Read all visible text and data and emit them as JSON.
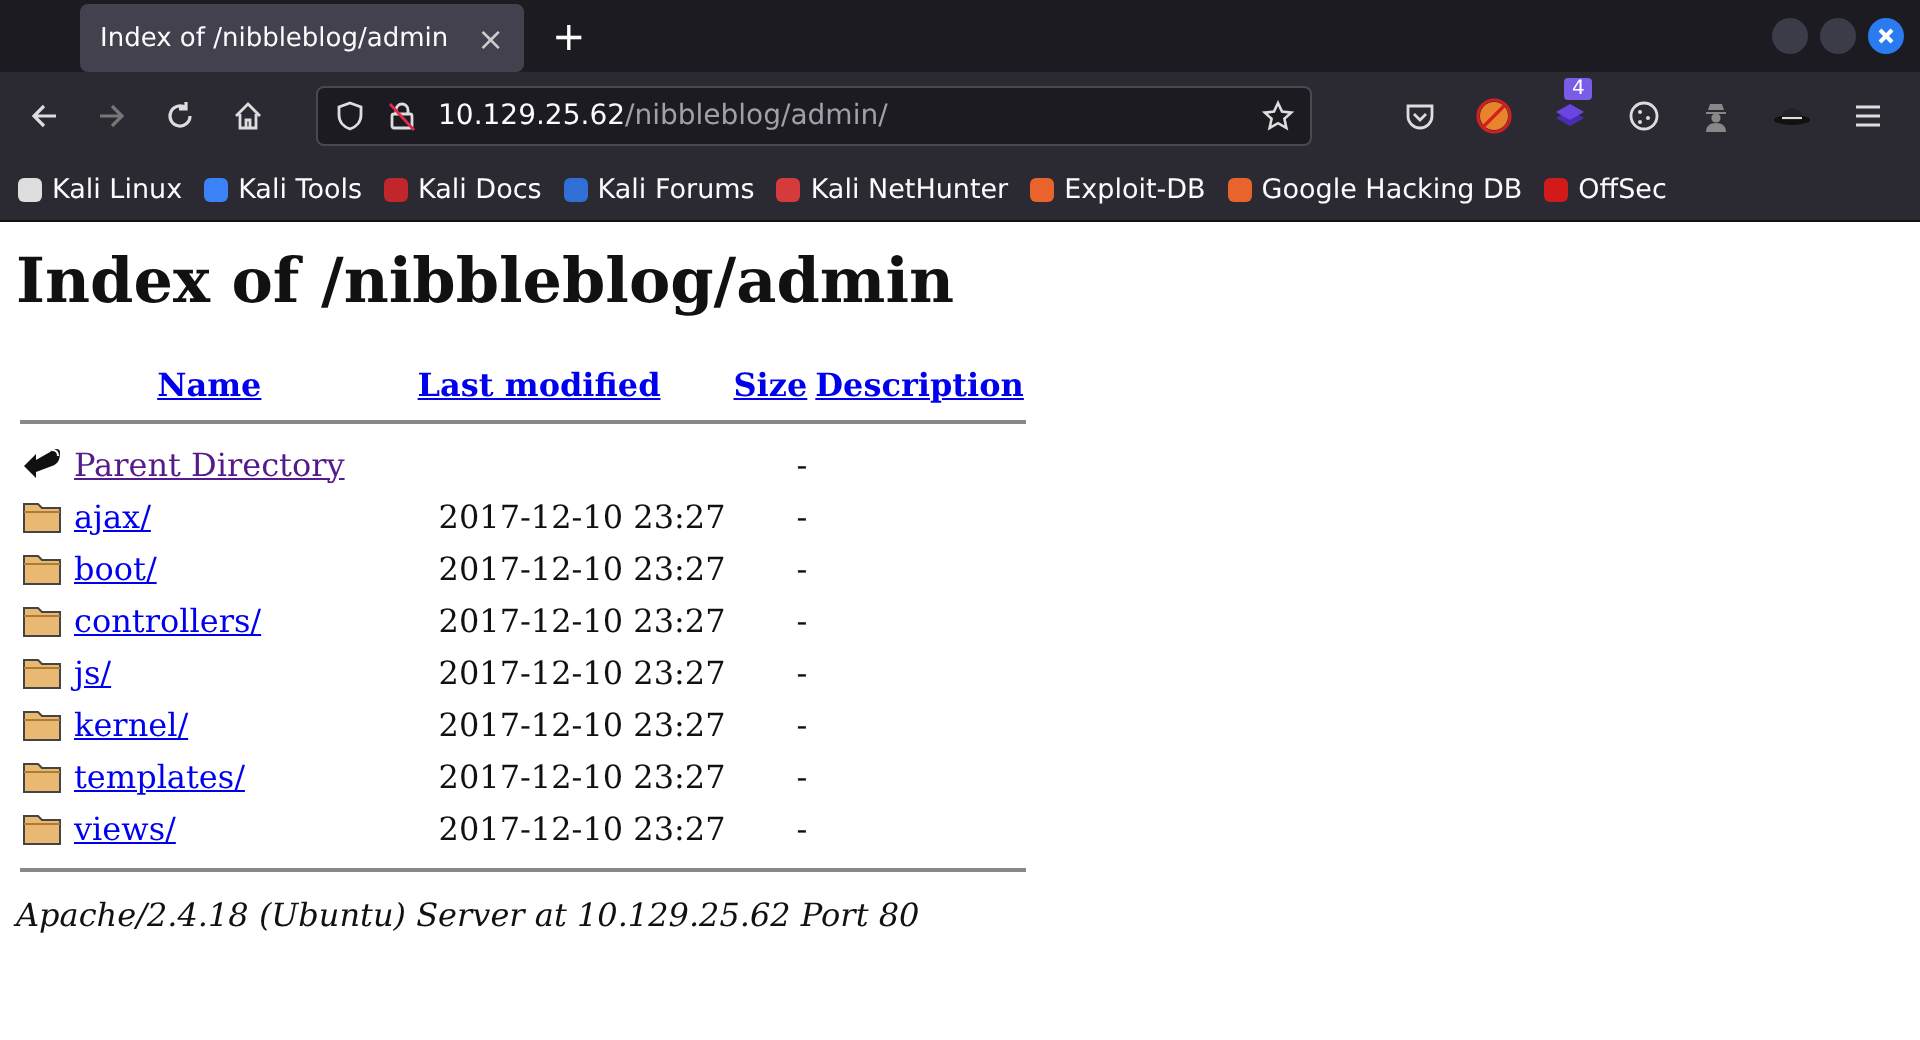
{
  "tab": {
    "title": "Index of /nibbleblog/admin",
    "close": "×",
    "new_tab": "+"
  },
  "address_bar": {
    "host": "10.129.25.62",
    "path": "/nibbleblog/admin/"
  },
  "extension_badge": "4",
  "bookmarks": [
    {
      "label": "Kali Linux",
      "color": "#dddddd"
    },
    {
      "label": "Kali Tools",
      "color": "#3b82f6"
    },
    {
      "label": "Kali Docs",
      "color": "#c0262c"
    },
    {
      "label": "Kali Forums",
      "color": "#2f6fd6"
    },
    {
      "label": "Kali NetHunter",
      "color": "#d63b3b"
    },
    {
      "label": "Exploit-DB",
      "color": "#e8642c"
    },
    {
      "label": "Google Hacking DB",
      "color": "#e8642c"
    },
    {
      "label": "OffSec",
      "color": "#d11a1a"
    }
  ],
  "page": {
    "heading": "Index of /nibbleblog/admin",
    "columns": [
      "Name",
      "Last modified",
      "Size",
      "Description"
    ],
    "rows": [
      {
        "kind": "parent",
        "name": "Parent Directory",
        "modified": "",
        "size": "-",
        "visited": true
      },
      {
        "kind": "folder",
        "name": "ajax/",
        "modified": "2017-12-10 23:27",
        "size": "-",
        "visited": false
      },
      {
        "kind": "folder",
        "name": "boot/",
        "modified": "2017-12-10 23:27",
        "size": "-",
        "visited": false
      },
      {
        "kind": "folder",
        "name": "controllers/",
        "modified": "2017-12-10 23:27",
        "size": "-",
        "visited": false
      },
      {
        "kind": "folder",
        "name": "js/",
        "modified": "2017-12-10 23:27",
        "size": "-",
        "visited": false
      },
      {
        "kind": "folder",
        "name": "kernel/",
        "modified": "2017-12-10 23:27",
        "size": "-",
        "visited": false
      },
      {
        "kind": "folder",
        "name": "templates/",
        "modified": "2017-12-10 23:27",
        "size": "-",
        "visited": false
      },
      {
        "kind": "folder",
        "name": "views/",
        "modified": "2017-12-10 23:27",
        "size": "-",
        "visited": false
      }
    ],
    "footer": "Apache/2.4.18 (Ubuntu) Server at 10.129.25.62 Port 80"
  }
}
